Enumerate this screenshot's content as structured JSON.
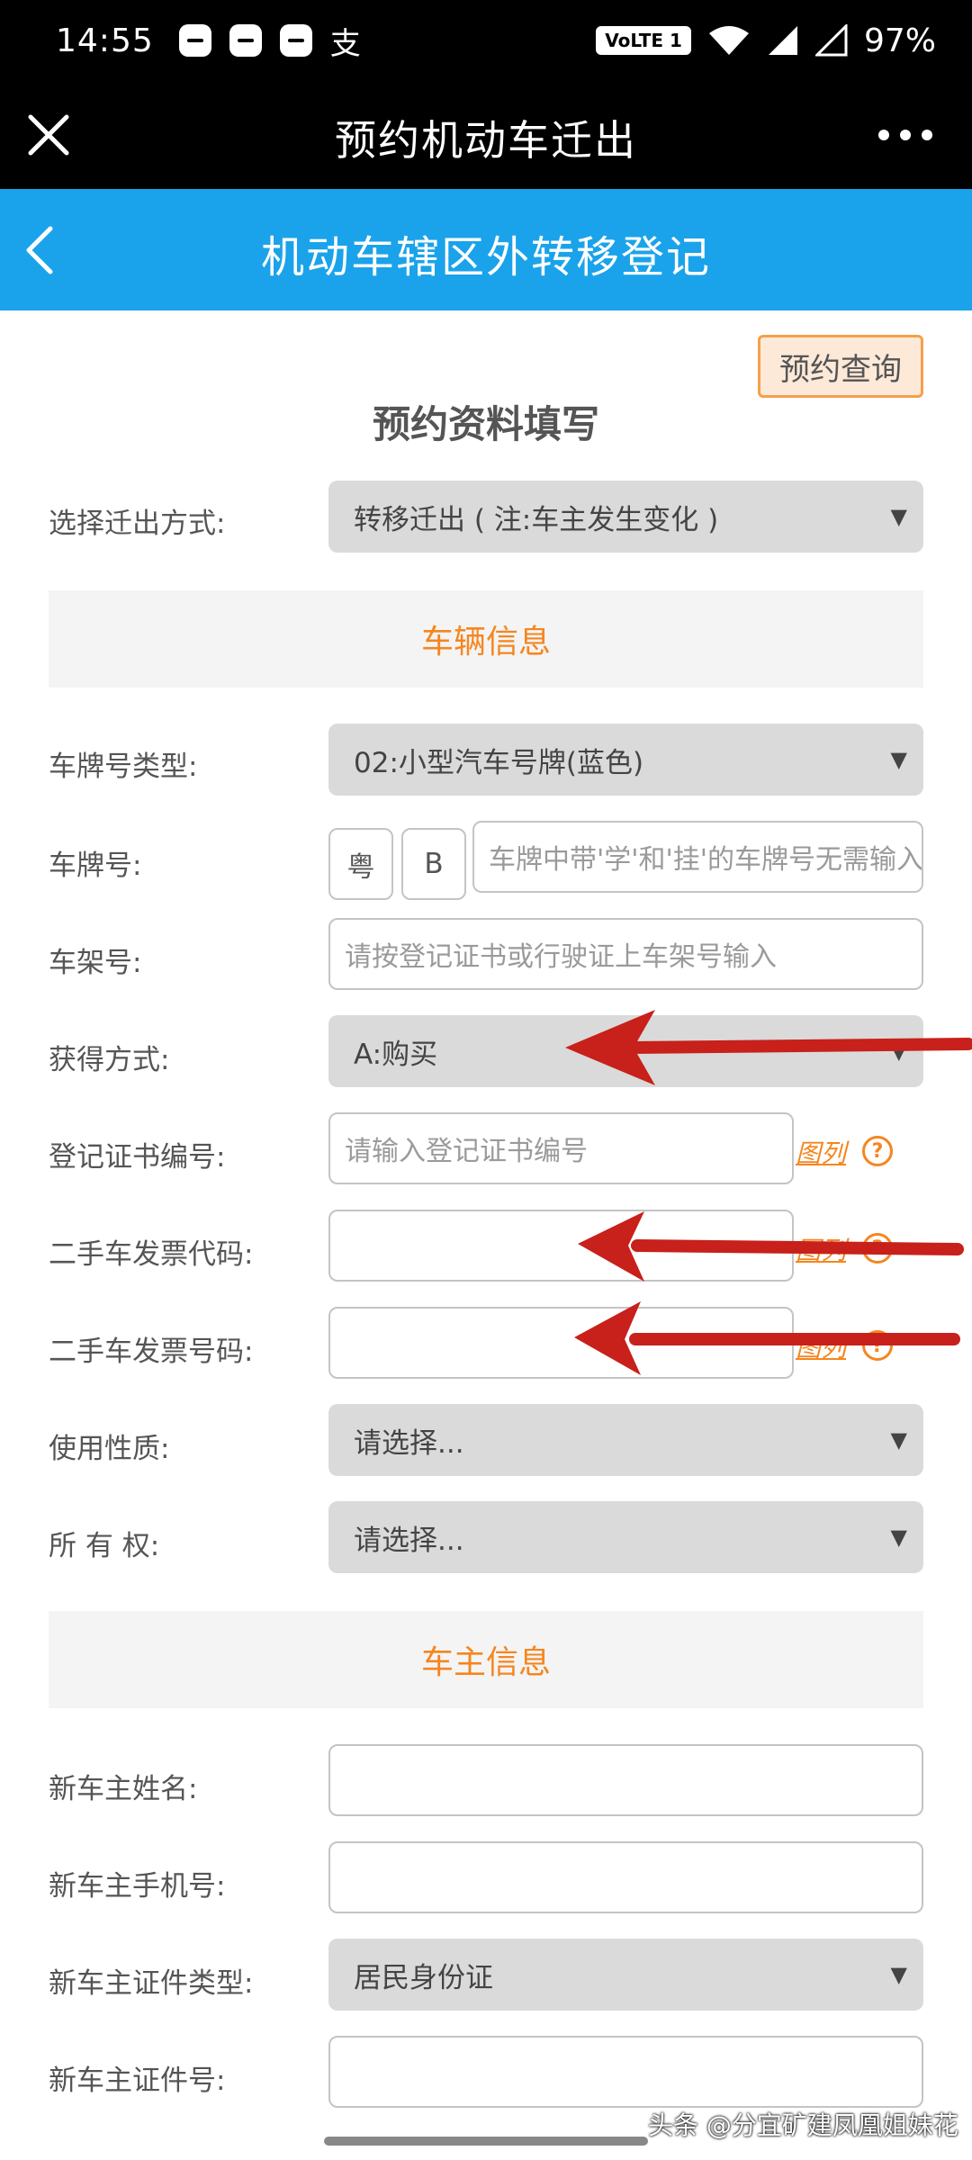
{
  "status_bar": {
    "time": "14:55",
    "app_char": "支",
    "volte": "VoLTE 1",
    "battery": "97%"
  },
  "title_bar": {
    "title": "预约机动车迁出"
  },
  "header": {
    "title": "机动车辖区外转移登记"
  },
  "query_button": "预约查询",
  "form_title": "预约资料填写",
  "transfer_method": {
    "label": "选择迁出方式:",
    "value": "转移迁出 ( 注:车主发生变化 )"
  },
  "vehicle_section": "车辆信息",
  "plate_type": {
    "label": "车牌号类型:",
    "value": "02:小型汽车号牌(蓝色)"
  },
  "plate_number": {
    "label": "车牌号:",
    "province": "粤",
    "letter": "B",
    "placeholder": "车牌中带'学'和'挂'的车牌号无需输入"
  },
  "vin": {
    "label": "车架号:",
    "placeholder": "请按登记证书或行驶证上车架号输入"
  },
  "acquire_method": {
    "label": "获得方式:",
    "value": "A:购买"
  },
  "cert_number": {
    "label": "登记证书编号:",
    "placeholder": "请输入登记证书编号",
    "example": "图列"
  },
  "invoice_code": {
    "label": "二手车发票代码:",
    "example": "图列"
  },
  "invoice_number": {
    "label": "二手车发票号码:",
    "example": "图列"
  },
  "usage": {
    "label": "使用性质:",
    "value": "请选择..."
  },
  "ownership": {
    "label": "所 有 权:",
    "value": "请选择..."
  },
  "owner_section": "车主信息",
  "owner_name": {
    "label": "新车主姓名:"
  },
  "owner_phone": {
    "label": "新车主手机号:"
  },
  "owner_id_type": {
    "label": "新车主证件类型:",
    "value": "居民身份证"
  },
  "owner_id_number": {
    "label": "新车主证件号:"
  },
  "watermark": "头条 @分宜矿建凤凰姐妹花",
  "colors": {
    "header_blue": "#1aa3ea",
    "accent_orange": "#f5861f",
    "arrow_red": "#c8201a"
  }
}
